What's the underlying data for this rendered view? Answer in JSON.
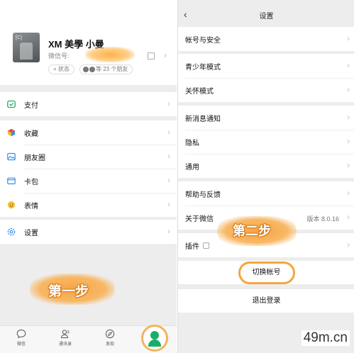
{
  "left": {
    "profile": {
      "avatar_text": "[C]",
      "nickname": "XM 美學 小曼",
      "wxid_label": "微信号:",
      "status_label": "+ 状态",
      "friends_label": "等 23 个朋友"
    },
    "menu": {
      "pay": "支付",
      "favorites": "收藏",
      "moments": "朋友圈",
      "cards": "卡包",
      "stickers": "表情",
      "settings": "设置"
    },
    "step_label": "第一步",
    "tabs": {
      "chats": "微信",
      "contacts": "通讯录",
      "discover": "发现"
    }
  },
  "right": {
    "title": "设置",
    "group1": {
      "account_security": "帐号与安全"
    },
    "group2": {
      "teen_mode": "青少年模式",
      "care_mode": "关怀模式"
    },
    "group3": {
      "notifications": "新消息通知",
      "privacy": "隐私",
      "general": "通用"
    },
    "group4": {
      "help": "帮助与反馈",
      "about": "关于微信",
      "version": "版本 8.0.16"
    },
    "group5": {
      "plugins": "插件"
    },
    "switch_account": "切换帐号",
    "logout": "退出登录",
    "step_label": "第二步"
  },
  "watermark": "49m.cn",
  "colors": {
    "accent_green": "#1aad6a",
    "highlight_orange": "#f4a63e"
  }
}
